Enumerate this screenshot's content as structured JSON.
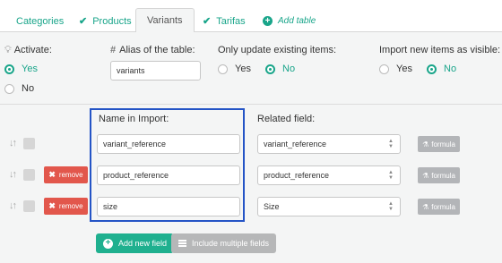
{
  "tabs": [
    {
      "label": "Categories",
      "icon": "",
      "active": false
    },
    {
      "label": "Products",
      "icon": "check-icon",
      "active": false
    },
    {
      "label": "Variants",
      "icon": "",
      "active": true
    },
    {
      "label": "Tarifas",
      "icon": "check-icon",
      "active": false
    },
    {
      "label": "Add table",
      "icon": "plus-circle-icon",
      "active": false
    }
  ],
  "settings": {
    "activate_label": "Activate:",
    "activate_yes": "Yes",
    "activate_no": "No",
    "alias_label": "Alias of the table:",
    "alias_value": "variants",
    "only_update_label": "Only update existing items:",
    "only_update_yes": "Yes",
    "only_update_no": "No",
    "import_visible_label": "Import new items as visible:",
    "import_visible_yes": "Yes",
    "import_visible_no": "No"
  },
  "fields": {
    "name_header": "Name in Import:",
    "related_header": "Related field:",
    "remove_label": "remove",
    "formula_label": "formula",
    "rows": [
      {
        "name": "variant_reference",
        "related": "variant_reference",
        "removable": false
      },
      {
        "name": "product_reference",
        "related": "product_reference",
        "removable": true
      },
      {
        "name": "size",
        "related": "Size",
        "removable": true
      }
    ]
  },
  "actions": {
    "add_field": "Add new field",
    "include_multiple": "Include multiple fields"
  },
  "colors": {
    "accent": "#19a58a",
    "remove": "#e2574c",
    "highlight_border": "#2454c6"
  }
}
